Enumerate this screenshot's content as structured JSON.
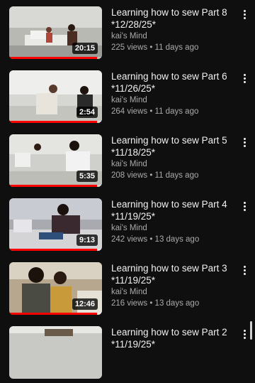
{
  "videos": [
    {
      "title_line1": "Learning how to sew Part 8",
      "title_line2": "*12/28/25*",
      "channel": "kai's Mind",
      "stats": "225 views • 11 days ago",
      "duration": "20:15",
      "progress": 0.95
    },
    {
      "title_line1": "Learning how to sew Part 6",
      "title_line2": "*11/26/25*",
      "channel": "kai's Mind",
      "stats": "264 views • 11 days ago",
      "duration": "2:54",
      "progress": 0.95
    },
    {
      "title_line1": "Learning how to sew Part 5",
      "title_line2": "*11/18/25*",
      "channel": "kai's Mind",
      "stats": "208 views • 11 days ago",
      "duration": "5:35",
      "progress": 0.95
    },
    {
      "title_line1": "Learning how to sew Part 4",
      "title_line2": "*11/19/25*",
      "channel": "kai's Mind",
      "stats": "242 views • 13 days ago",
      "duration": "9:13",
      "progress": 0.95
    },
    {
      "title_line1": "Learning how to sew Part 3",
      "title_line2": "*11/19/25*",
      "channel": "kai's Mind",
      "stats": "216 views • 13 days ago",
      "duration": "12:46",
      "progress": 0.95
    },
    {
      "title_line1": "Learning how to sew Part 2",
      "title_line2": "*11/19/25*",
      "channel": "",
      "stats": "",
      "duration": "",
      "progress": 0
    }
  ],
  "icons": {
    "more": "more-vertical-icon"
  },
  "colors": {
    "background": "#0f0f0f",
    "progress": "#ff0000",
    "secondary_text": "#aaaaaa"
  }
}
